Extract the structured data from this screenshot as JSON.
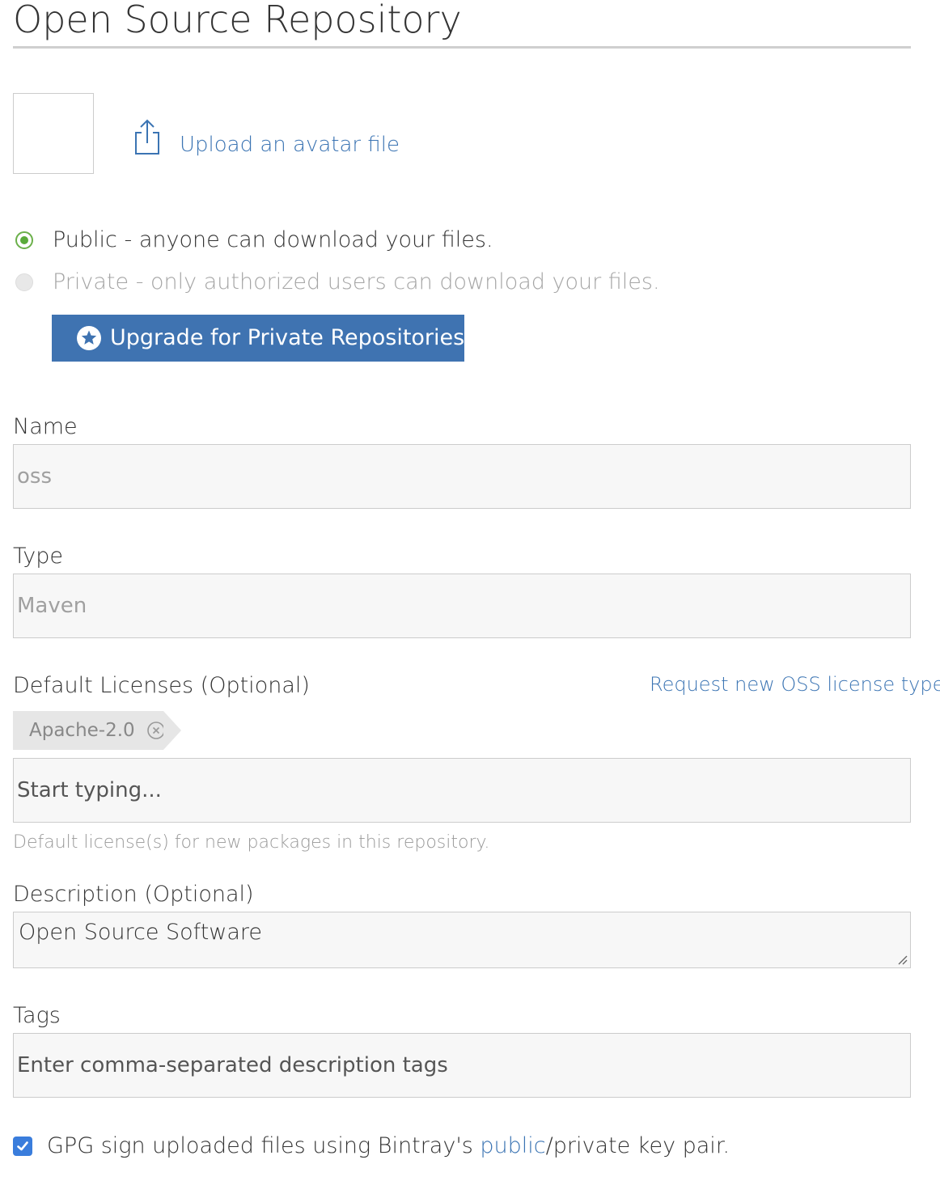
{
  "page": {
    "title": "Open Source Repository"
  },
  "avatar": {
    "upload_label": "Upload an avatar file",
    "icon": "upload-icon"
  },
  "visibility": {
    "selected": "public",
    "public_label": "Public - anyone can download your files.",
    "private_label": "Private - only authorized users can download your files.",
    "upgrade_button_label": "Upgrade for Private Repositories",
    "upgrade_icon": "star-circle-icon"
  },
  "name_field": {
    "label": "Name",
    "value": "oss",
    "disabled": true
  },
  "type_field": {
    "label": "Type",
    "value": "Maven",
    "disabled": true
  },
  "licenses": {
    "label": "Default Licenses (Optional)",
    "request_link": "Request new OSS license type",
    "tags": [
      "Apache-2.0"
    ],
    "placeholder": "Start typing...",
    "help_text": "Default license(s) for new packages in this repository."
  },
  "description": {
    "label": "Description (Optional)",
    "value": "Open Source Software"
  },
  "tags_field": {
    "label": "Tags",
    "placeholder": "Enter comma-separated description tags"
  },
  "gpg": {
    "checked": true,
    "text_before": "GPG sign uploaded files using Bintray's ",
    "link_text": "public",
    "text_after": "/private key pair."
  },
  "colors": {
    "link": "#3b74b3",
    "button": "#3f73b1",
    "radio_selected": "#5aab3a",
    "checkbox": "#3a7ddc"
  }
}
